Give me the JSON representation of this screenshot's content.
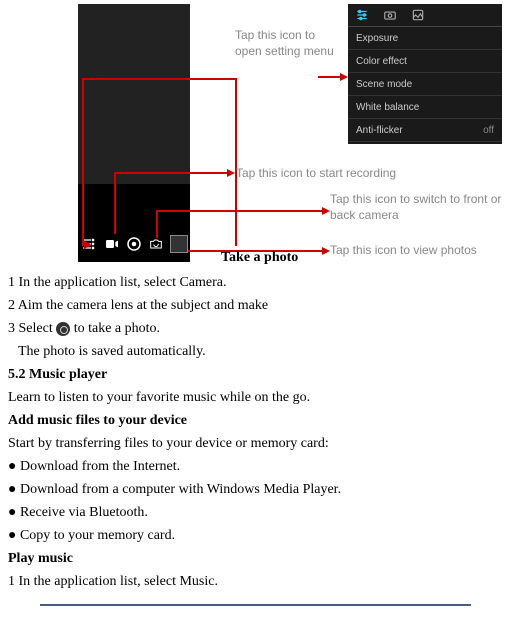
{
  "callouts": {
    "c1": "Tap this icon to open setting menu",
    "c2": "Tap this icon to start recording",
    "c3": "Tap this icon to switch to front or back camera",
    "c4": "Tap this icon to view photos"
  },
  "settings_panel": {
    "rows": {
      "r1": "Exposure",
      "r2": "Color effect",
      "r3": "Scene mode",
      "r4": "White balance",
      "r5": "Anti-flicker",
      "r5_value": "off"
    }
  },
  "caption": "Take a photo",
  "body": {
    "step1": "1 In the application list, select Camera.",
    "step2": "2 Aim the camera lens at the subject and make",
    "step3a": "3 Select ",
    "step3b": " to take a photo.",
    "saved": "The photo is saved automatically.",
    "music_title": "5.2 Music player",
    "music_intro": "Learn to listen to your favorite music while on the go.",
    "add_title": "Add music files to your device",
    "add_intro": "Start by transferring files to your device or memory card:",
    "bul1": "● Download from the Internet.",
    "bul2": "● Download from a computer with Windows Media Player.",
    "bul3": "● Receive via Bluetooth.",
    "bul4": "● Copy to your memory card.",
    "play_title": "Play music",
    "play_step1": "1 In the application list, select Music."
  }
}
